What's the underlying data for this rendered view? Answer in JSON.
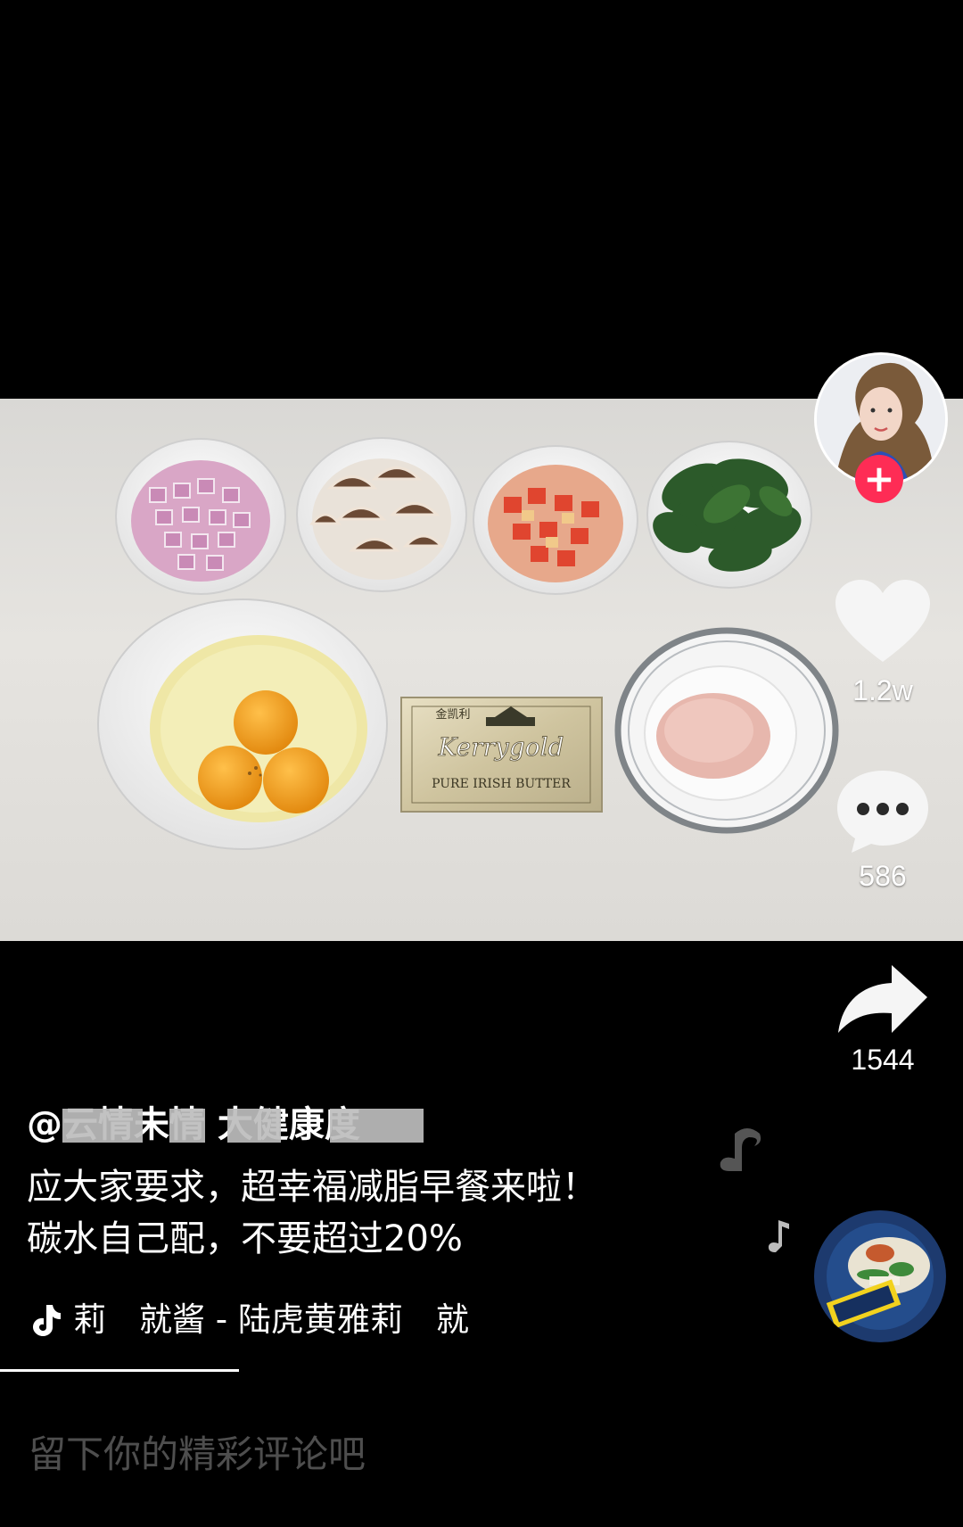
{
  "author": {
    "handle": "@云情未情 大健康度"
  },
  "caption": {
    "line1": "应大家要求，超幸福减脂早餐来啦！",
    "line2": "碳水自己配，不要超过20%"
  },
  "music": {
    "title": "莉　就酱 - 陆虎黄雅莉　就"
  },
  "actions": {
    "likes": "1.2w",
    "comments": "586",
    "shares": "1544"
  },
  "comment_box": {
    "placeholder": "留下你的精彩评论吧"
  },
  "video": {
    "butter_brand": "Kerrygold",
    "butter_subtitle": "PURE IRISH BUTTER",
    "butter_cn_brand": "金凯利"
  },
  "colors": {
    "follow": "#fe2c55",
    "background": "#000000"
  },
  "icons": [
    "heart-icon",
    "comment-bubble-icon",
    "share-arrow-icon",
    "tiktok-note-icon",
    "plus-icon"
  ]
}
